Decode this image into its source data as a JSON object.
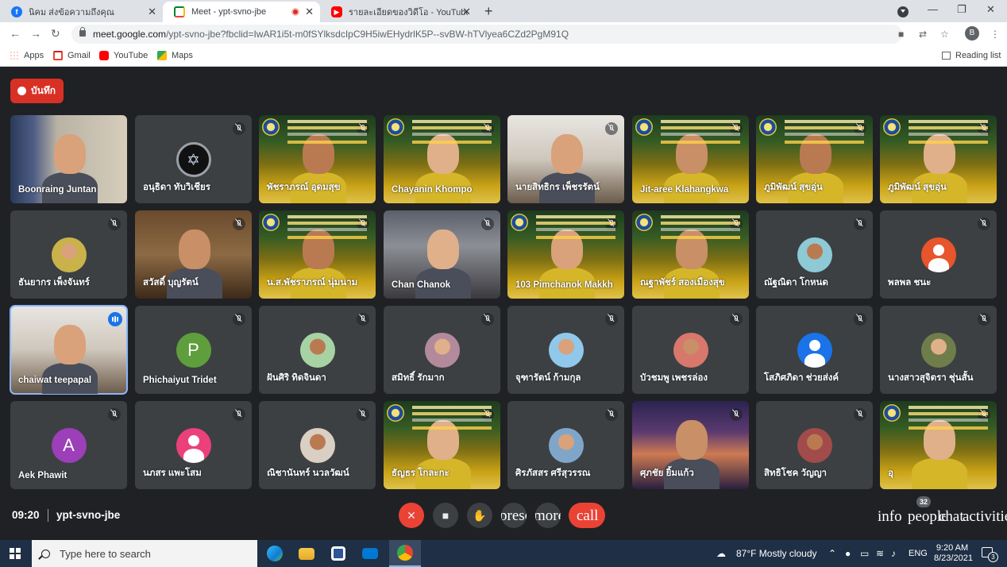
{
  "browser": {
    "tabs": [
      {
        "title": "นิคม ส่งข้อความถึงคุณ",
        "favicon": "facebook-icon",
        "color": "#1877f2"
      },
      {
        "title": "Meet - ypt-svno-jbe",
        "favicon": "meet-icon",
        "color": "#00832d"
      },
      {
        "title": "รายละเอียดของวิดีโอ - YouTube Stud",
        "favicon": "youtube-icon",
        "color": "#ff0000"
      }
    ],
    "url_host": "meet.google.com",
    "url_path": "/ypt-svno-jbe?fbclid=IwAR1i5t-m0fSYlksdcIpC9H5iwEHydrlK5P--svBW-hTVlyea6CZd2PgM91Q",
    "profile_initial": "B",
    "bookmarks": [
      "Apps",
      "Gmail",
      "YouTube",
      "Maps"
    ],
    "reading_list": "Reading list"
  },
  "meet": {
    "recording_label": "บันทึก",
    "clock": "09:20",
    "meeting_code": "ypt-svno-jbe",
    "participant_count": "32",
    "controls": {
      "present": "present now",
      "more": "more",
      "end_call": "call",
      "info": "info",
      "people": "people",
      "chat": "chat",
      "activities": "activities"
    },
    "tiles": [
      {
        "name": "Boonraing Juntan",
        "kind": "video",
        "bg": "books",
        "muted": false
      },
      {
        "name": "อนุธิดา ทับวิเชียร",
        "kind": "avatar",
        "avatar": "seal",
        "muted": true
      },
      {
        "name": "พัชราภรณ์ อุดมสุข",
        "kind": "video",
        "bg": "poster",
        "muted": true
      },
      {
        "name": "Chayanin Khompo",
        "kind": "video",
        "bg": "poster",
        "muted": true
      },
      {
        "name": "นายสิทธิกร เพ็ชรรัตน์",
        "kind": "video",
        "bg": "white",
        "muted": true
      },
      {
        "name": "Jit-aree Klahangkwa",
        "kind": "video",
        "bg": "poster",
        "muted": true
      },
      {
        "name": "ภูมิพัฒน์ สุขอุ่น",
        "kind": "video",
        "bg": "poster",
        "muted": true
      },
      {
        "name": "ภูมิพัฒน์ สุขอุ่น",
        "kind": "video",
        "bg": "poster",
        "muted": true
      },
      {
        "name": "ธันยากร เพ็งจันทร์",
        "kind": "avatar",
        "avatar": "photo",
        "avatar_color": "#c9b24a",
        "muted": true
      },
      {
        "name": "สวัสดิ์ บุญรัตน์",
        "kind": "video",
        "bg": "wood",
        "muted": true
      },
      {
        "name": "น.ส.พัชราภรณ์ นุ่มนาม",
        "kind": "video",
        "bg": "poster",
        "muted": true
      },
      {
        "name": "Chan Chanok",
        "kind": "video",
        "bg": "room",
        "muted": true
      },
      {
        "name": "103 Pimchanok Makkh",
        "kind": "video",
        "bg": "poster",
        "muted": true
      },
      {
        "name": "ณฐาพัชร์ สองเมืองสุข",
        "kind": "video",
        "bg": "poster",
        "muted": true
      },
      {
        "name": "ณัฐณิดา โกหนด",
        "kind": "avatar",
        "avatar": "photo",
        "avatar_color": "#8ec9d6",
        "muted": true
      },
      {
        "name": "พลพล ชนะ",
        "kind": "avatar",
        "avatar": "person",
        "avatar_color": "#e8542c",
        "muted": true
      },
      {
        "name": "chaiwat teepapal",
        "kind": "video",
        "bg": "white",
        "muted": false,
        "speaking": true
      },
      {
        "name": "Phichaiyut Tridet",
        "kind": "avatar",
        "avatar": "letter",
        "letter": "P",
        "avatar_color": "#5f9e3c",
        "muted": true
      },
      {
        "name": "ฝันศิริ ทิดจินดา",
        "kind": "avatar",
        "avatar": "photo",
        "avatar_color": "#a7d3a4",
        "muted": true
      },
      {
        "name": "สมิทธิ์ รักมาก",
        "kind": "avatar",
        "avatar": "photo",
        "avatar_color": "#b38a9c",
        "muted": true
      },
      {
        "name": "จุฑารัตน์ ก้ามกุล",
        "kind": "avatar",
        "avatar": "photo",
        "avatar_color": "#8fc8ea",
        "muted": true
      },
      {
        "name": "บัวชมพู เพชรล่อง",
        "kind": "avatar",
        "avatar": "photo",
        "avatar_color": "#d8776b",
        "muted": true
      },
      {
        "name": "โสภิศภิดา ช่วยส่งค์",
        "kind": "avatar",
        "avatar": "person",
        "avatar_color": "#1a73e8",
        "muted": true
      },
      {
        "name": "นางสาวสุจิตรา ชุ่นสั้น",
        "kind": "avatar",
        "avatar": "photo",
        "avatar_color": "#6f7d4a",
        "muted": true
      },
      {
        "name": "Aek Phawit",
        "kind": "avatar",
        "avatar": "letter",
        "letter": "A",
        "avatar_color": "#9c3fb8",
        "muted": true
      },
      {
        "name": "นภสร แพะโสม",
        "kind": "avatar",
        "avatar": "person",
        "avatar_color": "#ec407a",
        "muted": true
      },
      {
        "name": "ณิชานันทร์ นวลวัฒน์",
        "kind": "avatar",
        "avatar": "photo",
        "avatar_color": "#d9cfc3",
        "muted": true
      },
      {
        "name": "ธัญธร โกละกะ",
        "kind": "video",
        "bg": "poster",
        "muted": true
      },
      {
        "name": "ศิรภัสสร ศรีสุวรรณ",
        "kind": "avatar",
        "avatar": "photo",
        "avatar_color": "#7fa6c8",
        "muted": true
      },
      {
        "name": "ศุภชัย ยิ้มแก้ว",
        "kind": "video",
        "bg": "city",
        "muted": true
      },
      {
        "name": "สิทธิโชค วัญญา",
        "kind": "avatar",
        "avatar": "photo",
        "avatar_color": "#a24b4b",
        "muted": true
      },
      {
        "name": "อุ",
        "kind": "video",
        "bg": "poster",
        "muted": true
      }
    ]
  },
  "taskbar": {
    "search_placeholder": "Type here to search",
    "weather": "87°F  Mostly cloudy",
    "lang": "ENG",
    "time": "9:20 AM",
    "date": "8/23/2021",
    "notifications": "3"
  }
}
